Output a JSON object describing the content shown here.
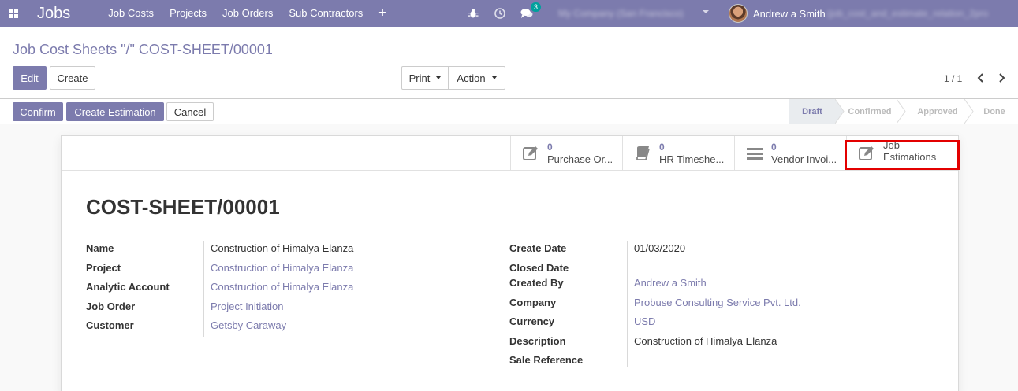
{
  "navbar": {
    "brand": "Jobs",
    "menu": [
      "Job Costs",
      "Projects",
      "Job Orders",
      "Sub Contractors"
    ],
    "plus": "+",
    "chat_badge": "3",
    "company": "My Company (San Francisco)",
    "user_name": "Andrew a Smith",
    "user_db": "(job_cost_and_estimate_relation_2pro"
  },
  "control_panel": {
    "breadcrumb": "Job Cost Sheets \"/\" COST-SHEET/00001",
    "edit_label": "Edit",
    "create_label": "Create",
    "print_label": "Print",
    "action_label": "Action",
    "pager": "1 / 1"
  },
  "statusbar": {
    "confirm_label": "Confirm",
    "create_estimation_label": "Create Estimation",
    "cancel_label": "Cancel",
    "stages": [
      "Draft",
      "Confirmed",
      "Approved",
      "Done"
    ],
    "active_stage": "Draft"
  },
  "smart_buttons": [
    {
      "count": "0",
      "label": "Purchase Or...",
      "icon": "edit-icon"
    },
    {
      "count": "0",
      "label": "HR Timeshe...",
      "icon": "book-icon"
    },
    {
      "count": "0",
      "label": "Vendor Invoi...",
      "icon": "list-icon"
    },
    {
      "label_line1": "Job",
      "label_line2": "Estimations",
      "icon": "edit-icon"
    }
  ],
  "record": {
    "title": "COST-SHEET/00001",
    "left_fields": [
      {
        "label": "Name",
        "value": "Construction of Himalya Elanza"
      },
      {
        "label": "Project",
        "value": "Construction of Himalya Elanza"
      },
      {
        "label": "Analytic Account",
        "value": "Construction of Himalya Elanza"
      },
      {
        "label": "Job Order",
        "value": "Project Initiation"
      },
      {
        "label": "Customer",
        "value": "Getsby Caraway"
      }
    ],
    "right_fields": [
      {
        "label": "Create Date",
        "value": "01/03/2020"
      },
      {
        "label": "Closed Date",
        "value": ""
      },
      {
        "label": "Created By",
        "value": "Andrew a Smith"
      },
      {
        "label": "Company",
        "value": "Probuse Consulting Service Pvt. Ltd."
      },
      {
        "label": "Currency",
        "value": "USD"
      },
      {
        "label": "Description",
        "value": "Construction of Himalya Elanza"
      },
      {
        "label": "Sale Reference",
        "value": ""
      }
    ]
  },
  "colors": {
    "brand": "#7c7bad",
    "highlight": "#e30000",
    "badge": "#00a09d"
  }
}
